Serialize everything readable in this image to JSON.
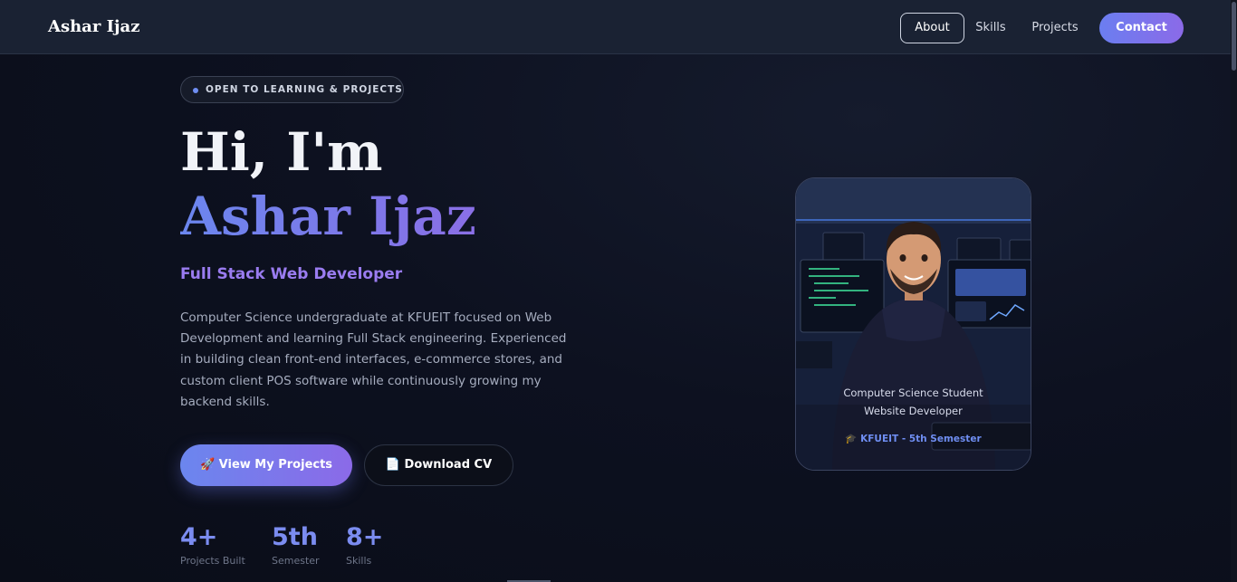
{
  "nav": {
    "brand": "Ashar Ijaz",
    "links": [
      "About",
      "Skills",
      "Projects"
    ],
    "contact_label": "Contact"
  },
  "hero": {
    "badge": "OPEN TO LEARNING & PROJECTS",
    "greeting": "Hi, I'm",
    "name": "Ashar Ijaz",
    "role": "Full Stack Web Developer",
    "bio": "Computer Science undergraduate at KFUEIT focused on Web Development and learning Full Stack engineering. Experienced in building clean front-end interfaces, e-commerce stores, and custom client POS software while continuously growing my backend skills.",
    "primary_button": "🚀 View My Projects",
    "secondary_button": "📄 Download CV",
    "stats": [
      {
        "value": "4+",
        "label": "Projects Built"
      },
      {
        "value": "5th",
        "label": "Semester"
      },
      {
        "value": "8+",
        "label": "Skills"
      }
    ]
  },
  "profile_card": {
    "caption_line1": "Computer Science Student",
    "caption_line2": "Website Developer",
    "university": "🎓 KFUEIT - 5th Semester"
  },
  "colors": {
    "accent": "#6b86ee",
    "accent_secondary": "#8b6ae8",
    "background": "#0d1120"
  }
}
